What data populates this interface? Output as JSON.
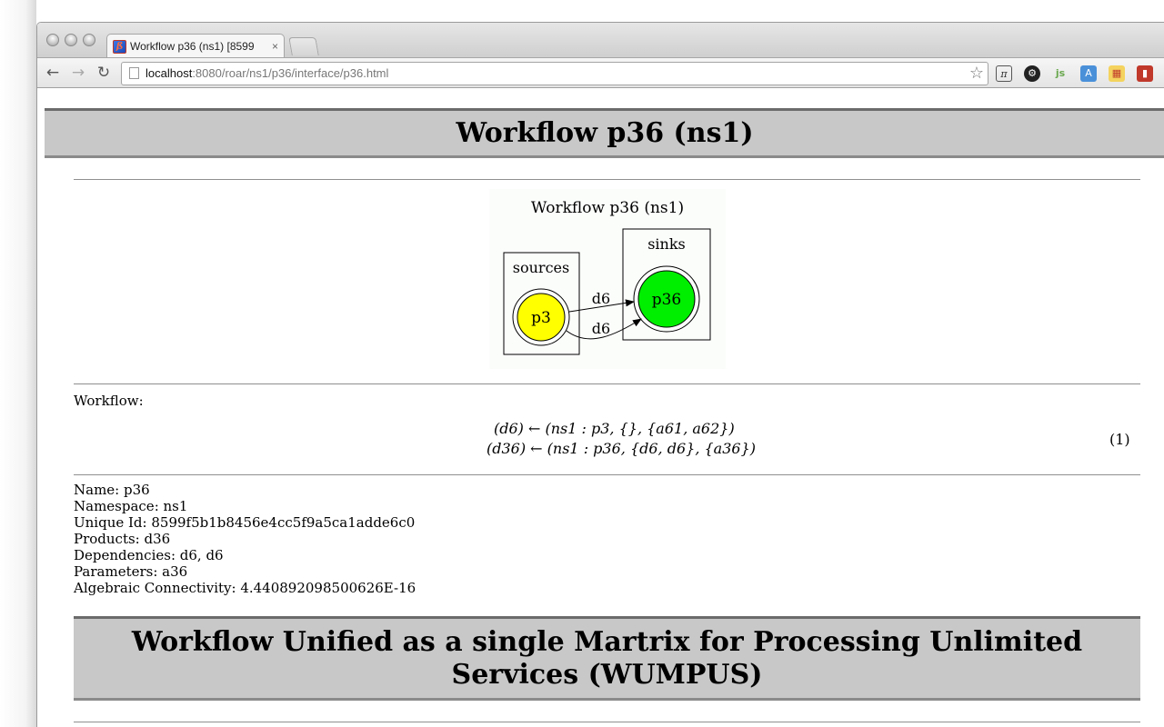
{
  "browser": {
    "tab_title": "Workflow p36 (ns1) [8599",
    "tab_close": "×",
    "url_host": "localhost",
    "url_path": ":8080/roar/ns1/p36/interface/p36.html",
    "favicon_glyph": "ß",
    "extensions": [
      "pi-icon",
      "gear-icon",
      "js-icon",
      "translate-icon",
      "puzzle-icon",
      "bookmark-icon"
    ]
  },
  "page": {
    "title": "Workflow p36 (ns1)",
    "graph": {
      "title": "Workflow p36 (ns1)",
      "sources_label": "sources",
      "sinks_label": "sinks",
      "source_node": "p3",
      "sink_node": "p36",
      "edge_labels": [
        "d6",
        "d6"
      ],
      "source_color": "#ffff00",
      "sink_color": "#00ee00"
    },
    "workflow_label": "Workflow:",
    "equations": [
      "(d6) ← (ns1 : p3, {}, {a61, a62})",
      "(d36) ← (ns1 : p36, {d6, d6}, {a36})"
    ],
    "equation_number": "(1)",
    "meta": {
      "name": "Name: p36",
      "namespace": "Namespace: ns1",
      "unique_id": "Unique Id: 8599f5b1b8456e4cc5f9a5ca1adde6c0",
      "products": "Products: d36",
      "dependencies": "Dependencies: d6, d6",
      "parameters": "Parameters: a36",
      "connectivity": "Algebraic Connectivity: 4.440892098500626E-16"
    },
    "footer_title": "Workflow Unified as a single Martrix for Processing Unlimited Services (WUMPUS)"
  }
}
